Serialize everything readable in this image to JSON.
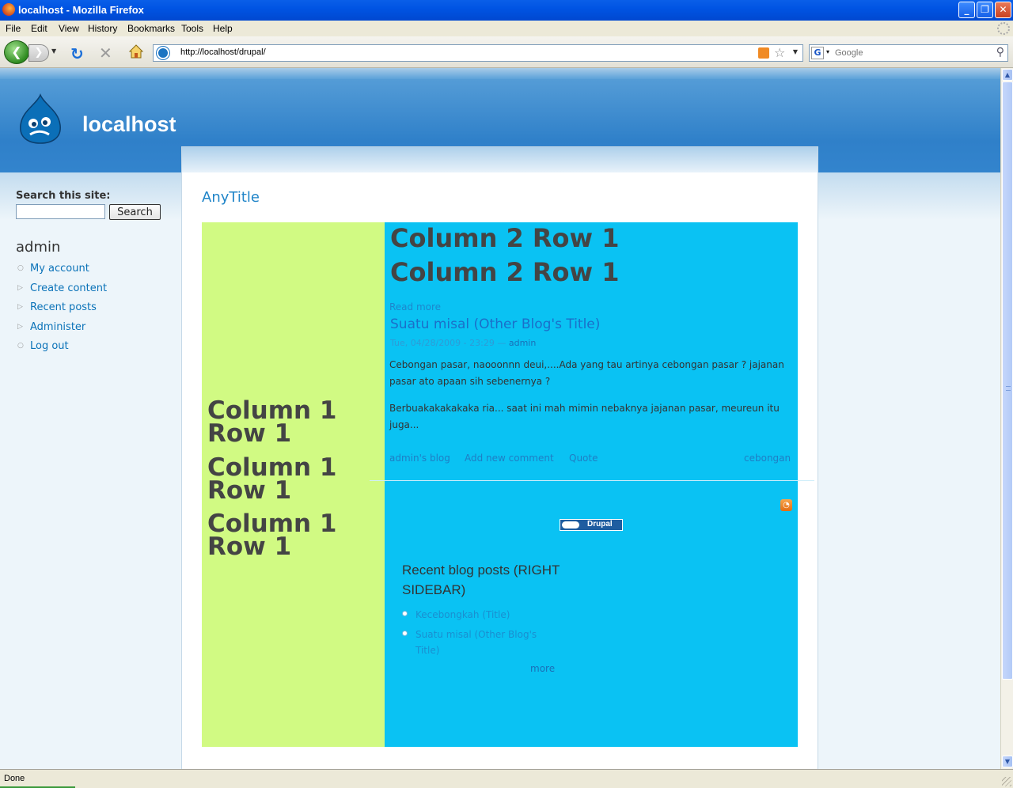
{
  "window": {
    "title": "localhost - Mozilla Firefox"
  },
  "menu": [
    "File",
    "Edit",
    "View",
    "History",
    "Bookmarks",
    "Tools",
    "Help"
  ],
  "toolbar": {
    "url": "http://localhost/drupal/",
    "search_placeholder": "Google"
  },
  "site": {
    "name": "localhost"
  },
  "sidebar": {
    "search_label": "Search this site:",
    "search_button": "Search",
    "user_title": "admin",
    "links": [
      "My account",
      "Create content",
      "Recent posts",
      "Administer",
      "Log out"
    ]
  },
  "main": {
    "page_title": "AnyTitle",
    "col1_rows": [
      "Column 1 Row 1",
      "Column 1 Row 1",
      "Column 1 Row 1"
    ],
    "col2_titles": [
      "Column 2 Row 1",
      "Column 2 Row 1"
    ],
    "read_more": "Read more",
    "post": {
      "title": "Suatu misal (Other Blog's Title)",
      "date": "Tue, 04/28/2009 - 23:29 —",
      "author": "admin",
      "paragraphs": [
        "Cebongan pasar, naooonnn deui,....Ada yang tau artinya cebongan pasar ? jajanan pasar ato apaan sih sebenernya ?",
        "Berbuakakakakaka ria... saat ini mah mimin nebaknya jajanan pasar, meureun itu juga..."
      ],
      "links": [
        "admin's blog",
        "Add new comment",
        "Quote"
      ],
      "tag": "cebongan"
    },
    "powered_by": "Drupal",
    "recent": {
      "title": "Recent blog posts (RIGHT SIDEBAR)",
      "items": [
        "Kecebongkah (Title)",
        "Suatu misal (Other Blog's Title)"
      ],
      "more": "more"
    }
  },
  "status": {
    "text": "Done"
  },
  "colors": {
    "col1_bg": "#d1fa83",
    "col2_bg": "#0ac2f3",
    "header_blue": "#2f80c9",
    "link_blue": "#0a72b8"
  }
}
